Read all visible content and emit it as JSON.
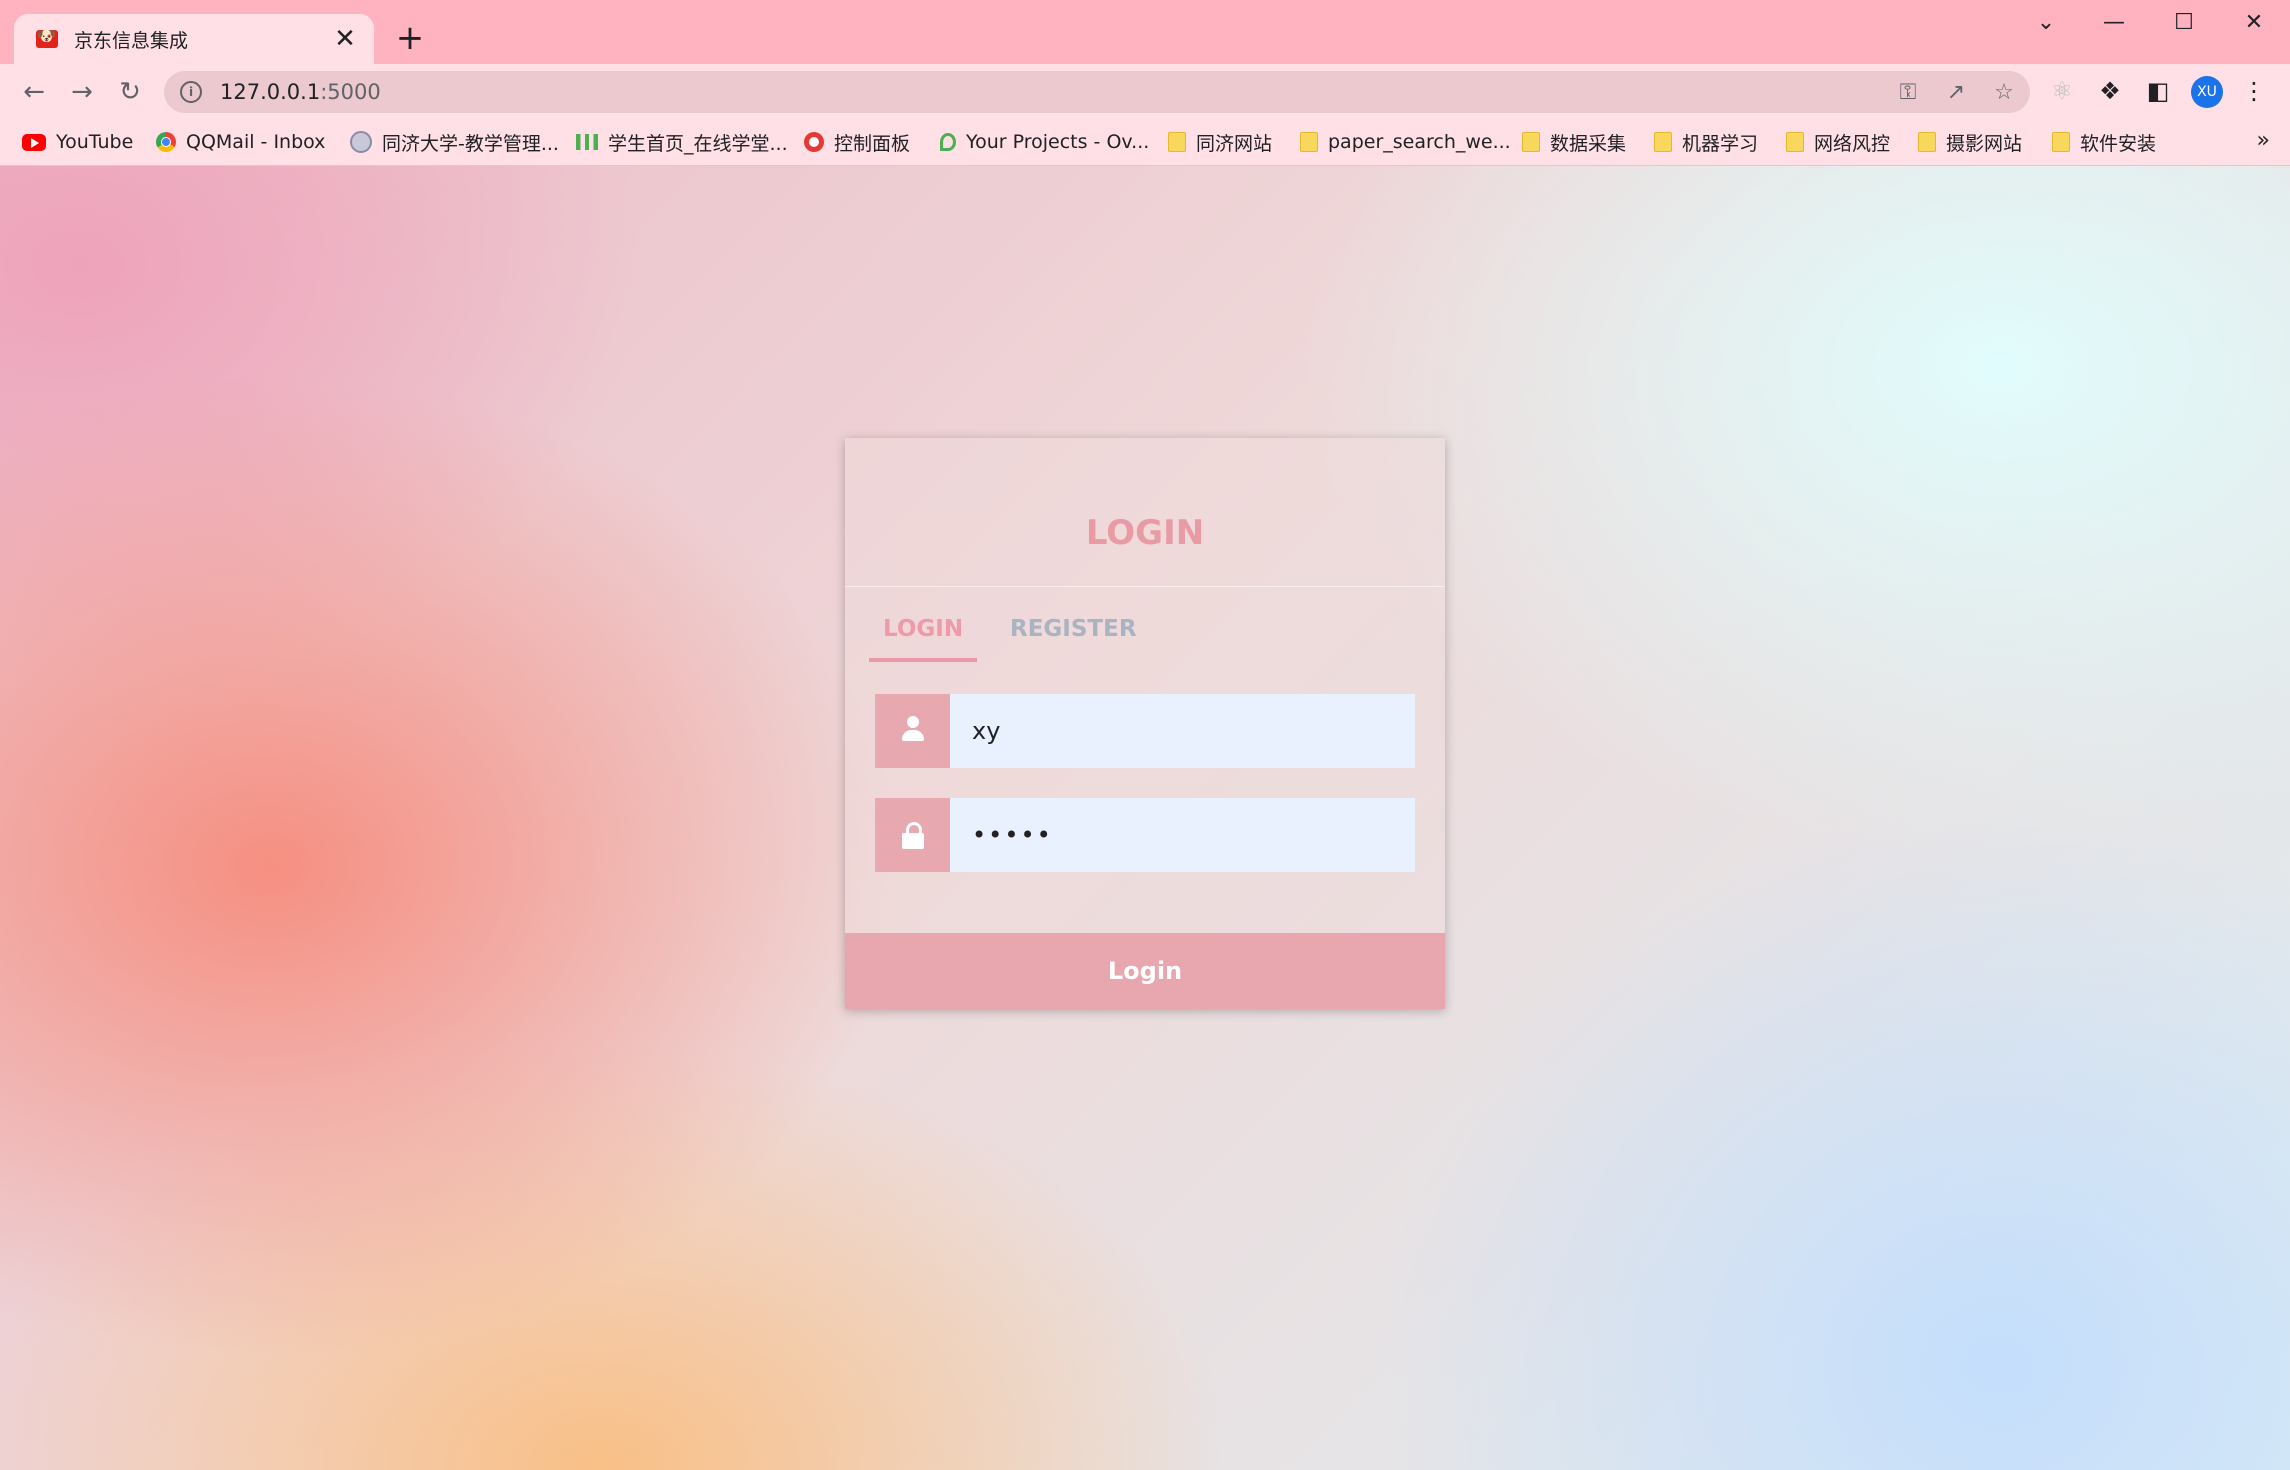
{
  "browser": {
    "tab_title": "京东信息集成",
    "tab_close": "✕",
    "new_tab": "+",
    "url_host": "127.0.0.1",
    "url_port": ":5000",
    "profile_initials": "XU",
    "window_controls": {
      "minimize": "—",
      "maximize": "☐",
      "close": "✕",
      "tab_search": "⌄"
    }
  },
  "bookmarks": [
    {
      "label": "YouTube",
      "icon": "youtube-icon"
    },
    {
      "label": "QQMail - Inbox",
      "icon": "chrome-icon"
    },
    {
      "label": "同济大学-教学管理...",
      "icon": "seal-icon"
    },
    {
      "label": "学生首页_在线学堂...",
      "icon": "wave-icon"
    },
    {
      "label": "控制面板",
      "icon": "control-panel-icon"
    },
    {
      "label": "Your Projects - Ov...",
      "icon": "leaf-icon"
    },
    {
      "label": "同济网站",
      "icon": "folder-icon"
    },
    {
      "label": "paper_search_we...",
      "icon": "folder-icon"
    },
    {
      "label": "数据采集",
      "icon": "folder-icon"
    },
    {
      "label": "机器学习",
      "icon": "folder-icon"
    },
    {
      "label": "网络风控",
      "icon": "folder-icon"
    },
    {
      "label": "摄影网站",
      "icon": "folder-icon"
    },
    {
      "label": "软件安装",
      "icon": "folder-icon"
    }
  ],
  "bookmarks_more": "»",
  "login_card": {
    "title": "LOGIN",
    "tabs": [
      {
        "label": "LOGIN",
        "active": true
      },
      {
        "label": "REGISTER",
        "active": false
      }
    ],
    "username_value": "xy",
    "password_value": "•••••",
    "submit_label": "Login",
    "colors": {
      "accent": "#e89aa5",
      "button": "#e8a6ae",
      "input_bg": "#e9f0fe",
      "inactive_tab": "#a9b3c2"
    }
  }
}
